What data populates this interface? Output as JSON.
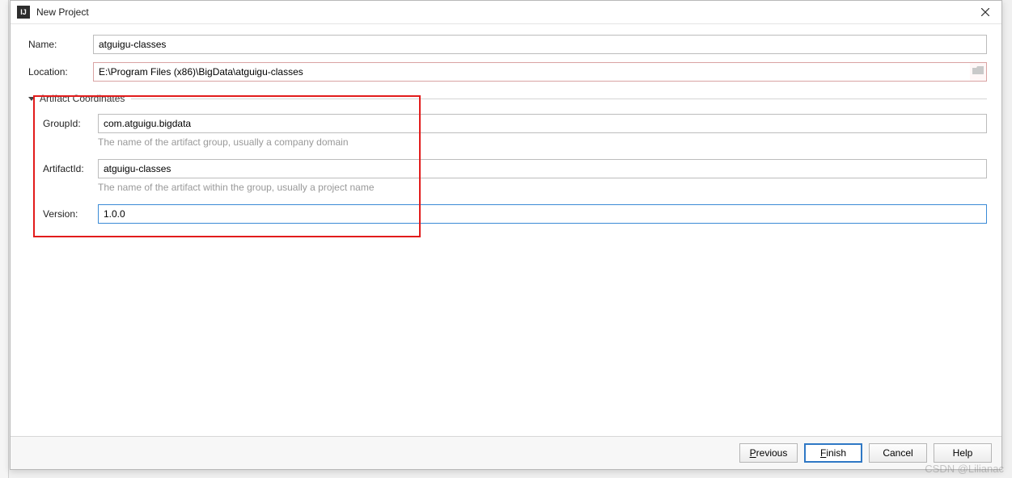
{
  "window": {
    "title": "New Project"
  },
  "form": {
    "name_label": "Name:",
    "name_value": "atguigu-classes",
    "location_label": "Location:",
    "location_value": "E:\\Program Files (x86)\\BigData\\atguigu-classes"
  },
  "section": {
    "title": "Artifact Coordinates"
  },
  "artifact": {
    "group_label": "GroupId:",
    "group_value": "com.atguigu.bigdata",
    "group_hint": "The name of the artifact group, usually a company domain",
    "artifact_label": "ArtifactId:",
    "artifact_value": "atguigu-classes",
    "artifact_hint": "The name of the artifact within the group, usually a project name",
    "version_label": "Version:",
    "version_value": "1.0.0"
  },
  "buttons": {
    "previous": "Previous",
    "finish": "Finish",
    "cancel": "Cancel",
    "help": "Help"
  },
  "watermark": "CSDN @Lilianac"
}
